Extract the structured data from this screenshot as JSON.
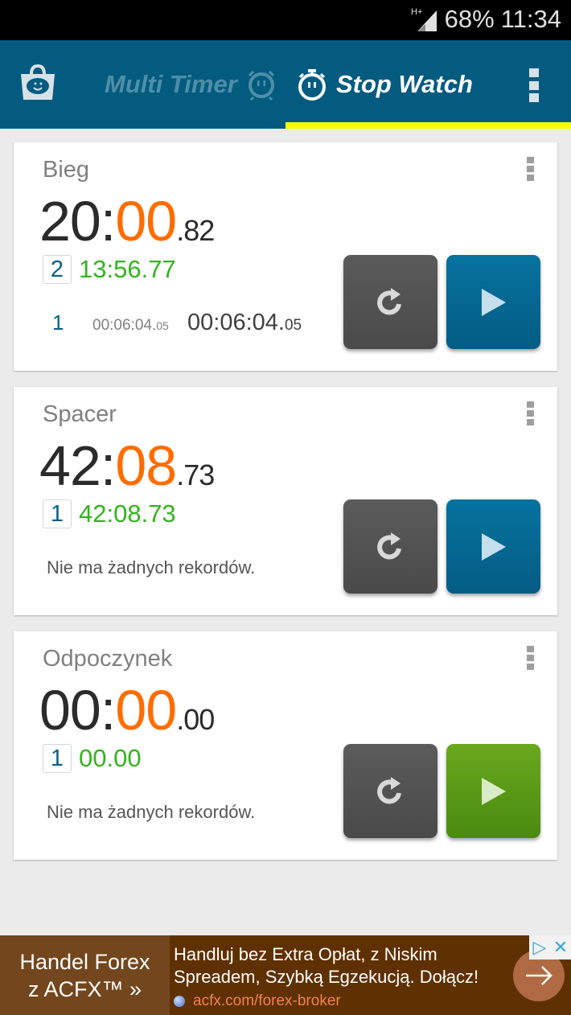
{
  "status_bar": {
    "network": "H+",
    "battery": "68%",
    "time": "11:34"
  },
  "app_bar": {
    "shop_icon": "shopping-bag-smiley-icon",
    "tabs": [
      {
        "label": "Multi Timer",
        "icon": "alarm-clock-face-icon",
        "active": false
      },
      {
        "label": "Stop Watch",
        "icon": "stopwatch-face-icon",
        "active": true
      }
    ],
    "overflow_icon": "more-vert-icon",
    "indicator_color": "#ffff00",
    "bar_color": "#045b80"
  },
  "stopwatches": [
    {
      "name": "Bieg",
      "time_main": "20:",
      "time_sec": "00",
      "time_cs": ".82",
      "lap_number": "2",
      "lap_time": "13:56.77",
      "records": [
        {
          "index": "1",
          "lap": "00:06:04.",
          "lap_cs": "05",
          "total": "00:06:04.",
          "total_cs": "05"
        }
      ],
      "empty_note": null,
      "play_color": "blue"
    },
    {
      "name": "Spacer",
      "time_main": "42:",
      "time_sec": "08",
      "time_cs": ".73",
      "lap_number": "1",
      "lap_time": "42:08.73",
      "records": [],
      "empty_note": "Nie ma żadnych rekordów.",
      "play_color": "blue"
    },
    {
      "name": "Odpoczynek",
      "time_main": "00:",
      "time_sec": "00",
      "time_cs": ".00",
      "lap_number": "1",
      "lap_time": "00.00",
      "records": [],
      "empty_note": "Nie ma żadnych rekordów.",
      "play_color": "green"
    }
  ],
  "colors": {
    "seconds_accent": "#ff6d00",
    "lap_time": "#34b31e",
    "play_blue": "#05699a",
    "play_green": "#5a9a16",
    "reset_gray": "#535353"
  },
  "ad": {
    "left_line1": "Handel Forex",
    "left_line2": "z ACFX™ »",
    "body_line1": "Handluj bez Extra Opłat, z Niskim",
    "body_line2": "Spreadem, Szybką Egzekucją. Dołącz!",
    "url": "acfx.com/forex-broker",
    "arrow": "→",
    "choices_icon": "▷",
    "close_icon": "✕"
  }
}
